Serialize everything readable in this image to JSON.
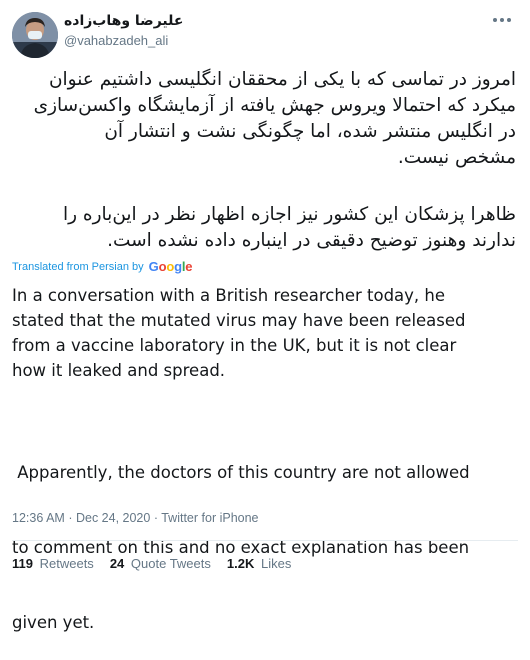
{
  "author": {
    "name": "علیرضا وهاب‌زاده",
    "handle": "@vahabzadeh_ali"
  },
  "tweet": {
    "persian_paragraph_1": [
      "امروز در تماسی که با یکی از محققان انگلیسی داشتیم عنوان",
      "میکرد که احتمالا ویروس جهش یافته از آزمایشگاه واکسن‌سازی",
      "در انگلیس منتشر شده، اما چگونگی نشت و انتشار آن",
      "مشخص نیست."
    ],
    "persian_paragraph_2": [
      "ظاهرا پزشکان این کشور نیز اجازه اظهار نظر در این‌باره را",
      "ندارند وهنوز توضیح دقیقی در اینباره داده نشده است."
    ],
    "translated_label": "Translated from Persian by",
    "translator_brand": "Google",
    "english_paragraph_1": [
      "In a conversation with a British researcher today, he",
      "stated that the mutated virus may have been released",
      "from a vaccine laboratory in the UK, but it is not clear",
      "how it leaked and spread."
    ],
    "english_paragraph_2": [
      " Apparently, the doctors of this country are not allowed",
      "to comment on this and no exact explanation has been",
      "given yet."
    ]
  },
  "meta": {
    "time": "12:36 AM",
    "separator": "·",
    "date": "Dec 24, 2020",
    "source": "Twitter for iPhone"
  },
  "stats": {
    "retweets_count": "119",
    "retweets_label": "Retweets",
    "quotes_count": "24",
    "quotes_label": "Quote Tweets",
    "likes_count": "1.2K",
    "likes_label": "Likes"
  },
  "colors": {
    "link": "#1b95e0",
    "secondary_text": "#657786",
    "primary_text": "#14171a",
    "google_blue": "#4285F4",
    "google_red": "#EA4335",
    "google_yellow": "#FBBC05",
    "google_green": "#34A853"
  }
}
